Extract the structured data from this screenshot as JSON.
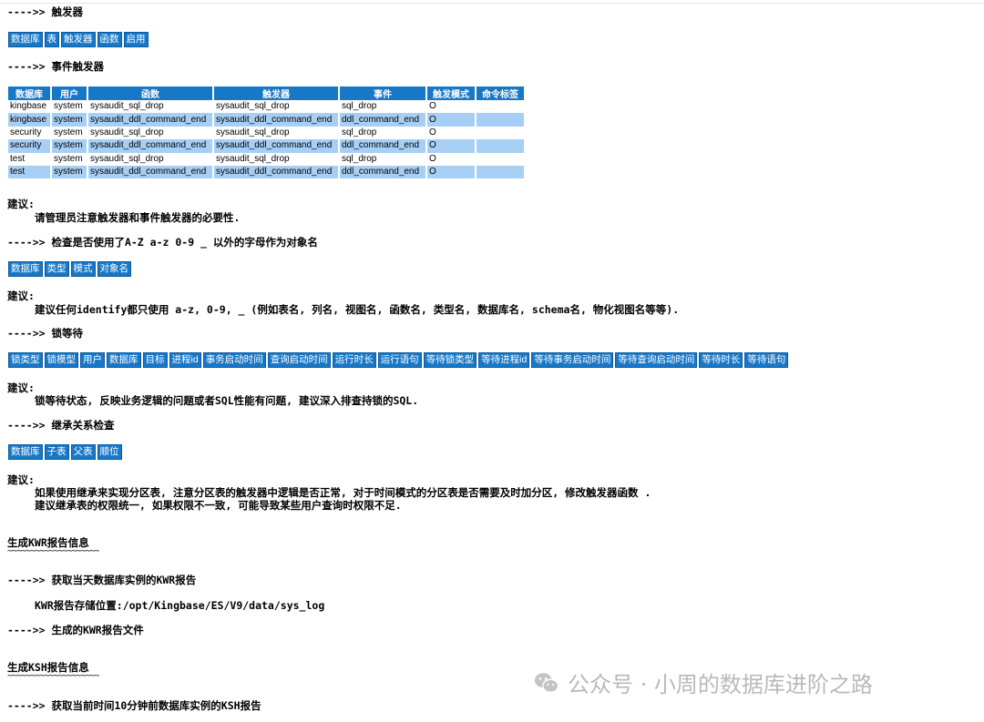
{
  "sec_trigger": "---->> 触发器",
  "trigger_headers": [
    "数据库",
    "表",
    "触发器",
    "函数",
    "启用"
  ],
  "sec_event_trigger": "---->> 事件触发器",
  "event_table": {
    "headers": [
      "数据库",
      "用户",
      "函数",
      "触发器",
      "事件",
      "触发模式",
      "命令标签"
    ],
    "rows": [
      [
        "kingbase",
        "system",
        "sysaudit_sql_drop",
        "sysaudit_sql_drop",
        "sql_drop",
        "O",
        ""
      ],
      [
        "kingbase",
        "system",
        "sysaudit_ddl_command_end",
        "sysaudit_ddl_command_end",
        "ddl_command_end",
        "O",
        ""
      ],
      [
        "security",
        "system",
        "sysaudit_sql_drop",
        "sysaudit_sql_drop",
        "sql_drop",
        "O",
        ""
      ],
      [
        "security",
        "system",
        "sysaudit_ddl_command_end",
        "sysaudit_ddl_command_end",
        "ddl_command_end",
        "O",
        ""
      ],
      [
        "test",
        "system",
        "sysaudit_sql_drop",
        "sysaudit_sql_drop",
        "sql_drop",
        "O",
        ""
      ],
      [
        "test",
        "system",
        "sysaudit_ddl_command_end",
        "sysaudit_ddl_command_end",
        "ddl_command_end",
        "O",
        ""
      ]
    ]
  },
  "advice_label": "建议:",
  "advice_1": "请管理员注意触发器和事件触发器的必要性.",
  "sec_name_check": "---->> 检查是否使用了A-Z a-z 0-9 _ 以外的字母作为对象名",
  "name_headers": [
    "数据库",
    "类型",
    "模式",
    "对象名"
  ],
  "advice_2": "建议任何identify都只使用 a-z, 0-9, _ (例如表名, 列名, 视图名, 函数名, 类型名, 数据库名, schema名, 物化视图名等等).",
  "sec_lock": "---->> 锁等待",
  "lock_headers": [
    "锁类型",
    "锁模型",
    "用户",
    "数据库",
    "目标",
    "进程id",
    "事务启动时间",
    "查询启动时间",
    "运行时长",
    "运行语句",
    "等待锁类型",
    "等待进程id",
    "等待事务启动时间",
    "等待查询启动时间",
    "等待时长",
    "等待语句"
  ],
  "advice_3": "锁等待状态, 反映业务逻辑的问题或者SQL性能有问题, 建议深入排查持锁的SQL.",
  "sec_inherit": "---->> 继承关系检查",
  "inherit_headers": [
    "数据库",
    "子表",
    "父表",
    "顺位"
  ],
  "advice_4a": "如果使用继承来实现分区表, 注意分区表的触发器中逻辑是否正常, 对于时间模式的分区表是否需要及时加分区, 修改触发器函数 .",
  "advice_4b": "建议继承表的权限统一, 如果权限不一致, 可能导致某些用户查询时权限不足.",
  "kwr_title": "生成KWR报告信息",
  "underline": "~~~~~~~~~~~~~~~~~~~~",
  "sec_kwr_today": "---->> 获取当天数据库实例的KWR报告",
  "kwr_location": "KWR报告存储位置:/opt/Kingbase/ES/V9/data/sys_log",
  "sec_kwr_file": "---->> 生成的KWR报告文件",
  "ksh_title": "生成KSH报告信息",
  "sec_ksh": "---->> 获取当前时间10分钟前数据库实例的KSH报告",
  "watermark": "公众号 · 小周的数据库进阶之路",
  "icon": "wechat-icon"
}
